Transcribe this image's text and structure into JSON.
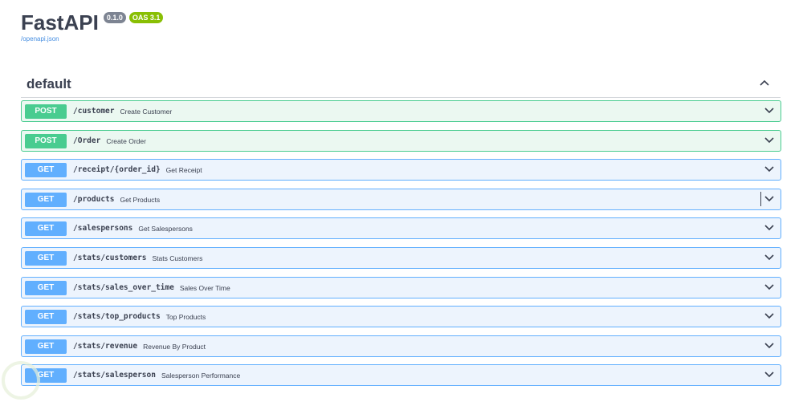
{
  "header": {
    "title": "FastAPI",
    "version": "0.1.0",
    "oas": "OAS 3.1",
    "spec_link": "/openapi.json"
  },
  "section": {
    "title": "default"
  },
  "operations": [
    {
      "method": "POST",
      "path": "/customer",
      "summary": "Create Customer"
    },
    {
      "method": "POST",
      "path": "/Order",
      "summary": "Create Order"
    },
    {
      "method": "GET",
      "path": "/receipt/{order_id}",
      "summary": "Get Receipt"
    },
    {
      "method": "GET",
      "path": "/products",
      "summary": "Get Products"
    },
    {
      "method": "GET",
      "path": "/salespersons",
      "summary": "Get Salespersons"
    },
    {
      "method": "GET",
      "path": "/stats/customers",
      "summary": "Stats Customers"
    },
    {
      "method": "GET",
      "path": "/stats/sales_over_time",
      "summary": "Sales Over Time"
    },
    {
      "method": "GET",
      "path": "/stats/top_products",
      "summary": "Top Products"
    },
    {
      "method": "GET",
      "path": "/stats/revenue",
      "summary": "Revenue By Product"
    },
    {
      "method": "GET",
      "path": "/stats/salesperson",
      "summary": "Salesperson Performance"
    }
  ]
}
